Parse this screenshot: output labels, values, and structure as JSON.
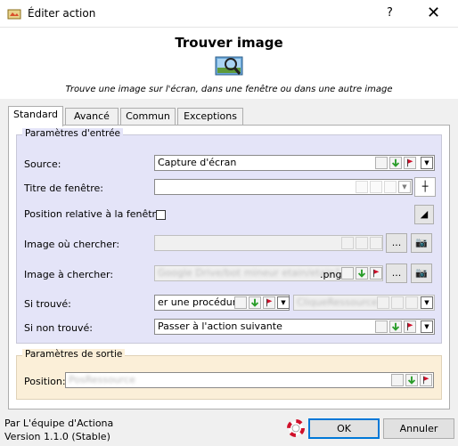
{
  "window": {
    "title": "Éditer action",
    "help_glyph": "?",
    "close_glyph": "✕"
  },
  "header": {
    "action_title": "Trouver image",
    "description": "Trouve une image sur l'écran, dans une fenêtre ou dans une autre image"
  },
  "tabs": [
    {
      "label": "Standard",
      "active": true
    },
    {
      "label": "Avancé",
      "active": false
    },
    {
      "label": "Commun",
      "active": false
    },
    {
      "label": "Exceptions",
      "active": false
    }
  ],
  "input_group": {
    "legend": "Paramètres d'entrée",
    "source": {
      "label": "Source:",
      "value": "Capture d'écran"
    },
    "window_title": {
      "label": "Titre de fenêtre:",
      "value": ""
    },
    "relative_position": {
      "label": "Position relative à la fenêtre:",
      "checked": false
    },
    "search_in_image": {
      "label": "Image où chercher:",
      "value": "",
      "browse_label": "..."
    },
    "image_to_find": {
      "label": "Image à chercher:",
      "value_blurred": "Google Drive/bot mineur etain/etain1",
      "value_suffix": ".png",
      "browse_label": "..."
    },
    "if_found": {
      "label": "Si trouvé:",
      "value": "er une procédure",
      "value2_blurred": "CliqueRessource"
    },
    "if_not_found": {
      "label": "Si non trouvé:",
      "value": "Passer à l'action suivante"
    }
  },
  "output_group": {
    "legend": "Paramètres de sortie",
    "position": {
      "label": "Position:",
      "value_blurred": "PosRessource"
    }
  },
  "footer": {
    "by": "Par L'équipe d'Actiona",
    "version": "Version 1.1.0 (Stable)",
    "ok_label": "OK",
    "cancel_label": "Annuler"
  },
  "colors": {
    "input_group_bg": "#e4e4f8",
    "output_group_bg": "#fbefd8",
    "accent": "#0078d7",
    "green_arrow": "#2a9d2a",
    "red_flag": "#d0102a"
  }
}
